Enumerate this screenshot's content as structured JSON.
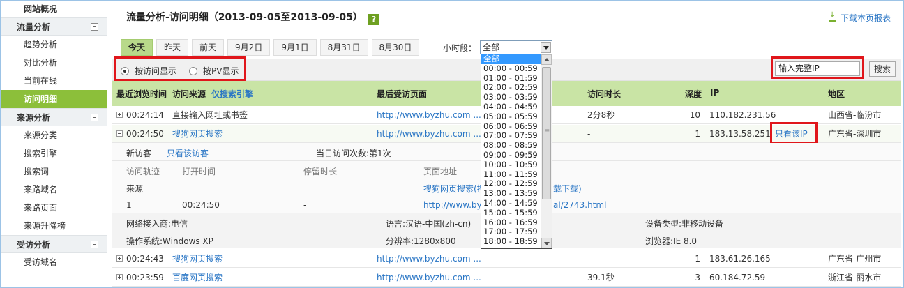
{
  "sidebar": {
    "top": "网站概况",
    "groups": [
      {
        "label": "流量分析",
        "items": [
          "趋势分析",
          "对比分析",
          "当前在线",
          "访问明细"
        ]
      },
      {
        "label": "来源分析",
        "items": [
          "来源分类",
          "搜索引擎",
          "搜索词",
          "来路域名",
          "来路页面",
          "来源升降榜"
        ]
      },
      {
        "label": "受访分析",
        "items": [
          "受访域名"
        ]
      }
    ],
    "active": "访问明细"
  },
  "header": {
    "title": "流量分析-访问明细（2013-09-05至2013-09-05）",
    "help": "?",
    "download": "下载本页报表"
  },
  "tabs": [
    "今天",
    "昨天",
    "前天",
    "9月2日",
    "9月1日",
    "8月31日",
    "8月30日"
  ],
  "hour": {
    "label": "小时段：",
    "selected": "全部",
    "options": [
      "全部",
      "00:00 - 00:59",
      "01:00 - 01:59",
      "02:00 - 02:59",
      "03:00 - 03:59",
      "04:00 - 04:59",
      "05:00 - 05:59",
      "06:00 - 06:59",
      "07:00 - 07:59",
      "08:00 - 08:59",
      "09:00 - 09:59",
      "10:00 - 10:59",
      "11:00 - 11:59",
      "12:00 - 12:59",
      "13:00 - 13:59",
      "14:00 - 14:59",
      "15:00 - 15:59",
      "16:00 - 16:59",
      "17:00 - 17:59",
      "18:00 - 18:59"
    ]
  },
  "toolbar": {
    "by_visit": "按访问显示",
    "by_pv": "按PV显示",
    "ip_value": "输入完整IP",
    "search": "搜索"
  },
  "table": {
    "headers": {
      "time": "最近浏览时间",
      "source": "访问来源",
      "only_search": "仅搜索引擎",
      "page": "最后受访页面",
      "duration": "访问时长",
      "depth": "深度",
      "ip": "IP",
      "region": "地区"
    },
    "rows": [
      {
        "time": "00:24:14",
        "source": "直接输入网址或书签",
        "page": "http://www.byzhu.com ...",
        "duration": "2分8秒",
        "depth": "10",
        "ip": "110.182.231.56",
        "region": "山西省-临汾市"
      },
      {
        "time": "00:24:50",
        "source": "搜狗网页搜索",
        "page": "http://www.byzhu.com ...",
        "duration": "-",
        "depth": "1",
        "ip": "183.13.58.251",
        "only_ip": "只看该IP",
        "region": "广东省-深圳市"
      },
      {
        "time": "00:24:43",
        "source": "搜狗网页搜索",
        "page": "http://www.byzhu.com ...",
        "duration": "-",
        "depth": "1",
        "ip": "183.61.26.165",
        "region": "广东省-广州市"
      },
      {
        "time": "00:23:59",
        "source": "百度网页搜索",
        "page": "http://www.byzhu.com ...",
        "duration": "39.1秒",
        "depth": "3",
        "ip": "60.184.72.59",
        "region": "浙江省-丽水市"
      }
    ]
  },
  "detail": {
    "new_visitor": "新访客",
    "only_visitor": "只看该访客",
    "daily_visits": "当日访问次数:第1次",
    "cols": {
      "trail": "访问轨迹",
      "open_time": "打开时间",
      "stay": "停留时长",
      "page_url": "页面地址"
    },
    "source_label": "来源",
    "source_stay": "-",
    "source_url": "搜狗网页搜索(搜",
    "source_url_tail": "载下载)",
    "step": "1",
    "step_time": "00:24:50",
    "step_stay": "-",
    "step_url": "http://www.byz",
    "step_url_tail": "al/2743.html"
  },
  "info": {
    "isp": "网络接入商:电信",
    "language": "语言:汉语-中国(zh-cn)",
    "device": "设备类型:非移动设备",
    "os": "操作系统:Windows XP",
    "resolution": "分辨率:1280x800",
    "browser": "浏览器:IE 8.0"
  }
}
